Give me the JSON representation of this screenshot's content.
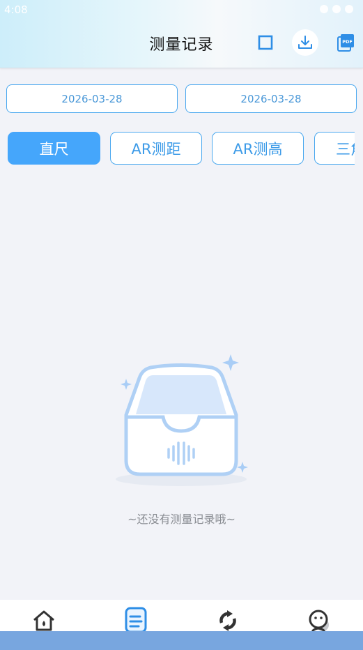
{
  "status_bar": {
    "time": "4:08"
  },
  "header": {
    "title": "测量记录",
    "icons": [
      "select-square-icon",
      "download-icon",
      "pdf-icon"
    ]
  },
  "date_range": {
    "start": "2026-03-28",
    "end": "2026-03-28"
  },
  "tabs": [
    {
      "label": "直尺",
      "active": true
    },
    {
      "label": "AR测距",
      "active": false
    },
    {
      "label": "AR测高",
      "active": false
    },
    {
      "label": "三角",
      "active": false
    }
  ],
  "empty_state": {
    "message": "~还没有测量记录哦~"
  },
  "bottom_nav": {
    "items": [
      {
        "icon": "home-icon"
      },
      {
        "icon": "records-icon",
        "active": true
      },
      {
        "icon": "refresh-icon"
      },
      {
        "icon": "profile-icon"
      }
    ]
  },
  "colors": {
    "accent": "#45a6fb",
    "border": "#4aa8ef",
    "background": "#f2f3f8"
  }
}
